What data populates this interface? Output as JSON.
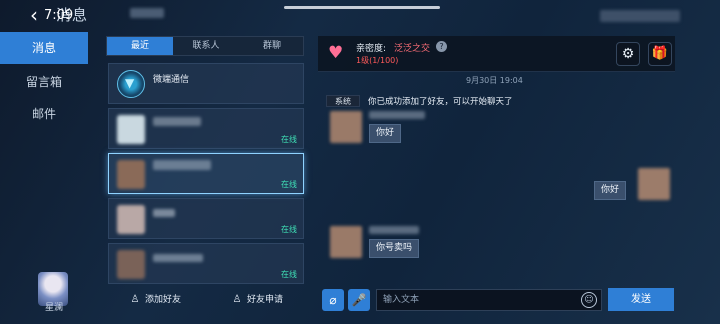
{
  "status_bar": {
    "time": "7:09"
  },
  "header": {
    "back_icon": "chevron-left-icon",
    "title": "消息"
  },
  "nav": {
    "items": [
      {
        "label": "消息",
        "active": true
      },
      {
        "label": "留言箱",
        "active": false
      },
      {
        "label": "邮件",
        "active": false
      }
    ],
    "user_name": "星澜"
  },
  "tabs": [
    {
      "label": "最近",
      "active": true
    },
    {
      "label": "联系人",
      "active": false
    },
    {
      "label": "群聊",
      "active": false
    }
  ],
  "contacts": [
    {
      "name": "微端通信",
      "icon": "signal-icon",
      "status": ""
    },
    {
      "name": "",
      "status": "在线"
    },
    {
      "name": "",
      "status": "在线",
      "selected": true
    },
    {
      "name": "",
      "status": "在线"
    },
    {
      "name": "",
      "status": "在线"
    }
  ],
  "bottom_actions": {
    "add_friend": "添加好友",
    "friend_requests": "好友申请"
  },
  "chat": {
    "intimacy_label": "亲密度:",
    "intimacy_value": "泛泛之交",
    "help_icon": "?",
    "level": "1级(1/100)",
    "timestamp": "9月30日 19:04",
    "system_tag": "系统",
    "system_message": "你已成功添加了好友，可以开始聊天了",
    "messages": [
      {
        "side": "left",
        "text": "你好"
      },
      {
        "side": "right",
        "text": "你好"
      },
      {
        "side": "left",
        "text": "你号卖吗"
      }
    ]
  },
  "input": {
    "placeholder": "输入文本",
    "send_label": "发送"
  },
  "colors": {
    "accent": "#2f7fd6",
    "online": "#3fe0b6",
    "intimacy": "#ff6f78"
  }
}
